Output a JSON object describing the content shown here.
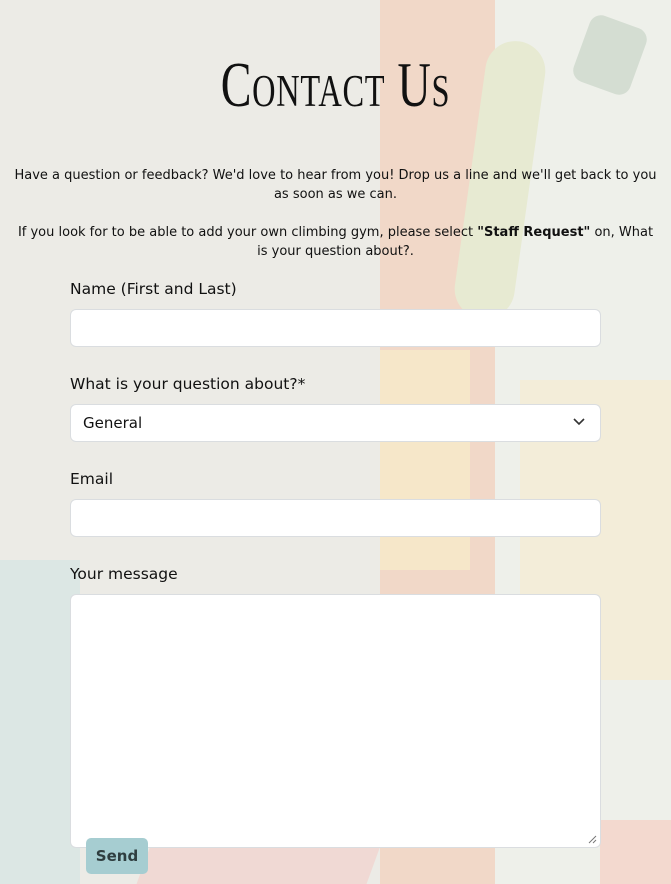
{
  "page": {
    "title": "Contact Us",
    "intro_line1": "Have a question or feedback? We'd love to hear from you! Drop us a line and we'll get back to you as soon as we can.",
    "intro_line2_pre": "If you look for to be able to add your own climbing gym, please select ",
    "intro_line2_bold": "\"Staff Request\"",
    "intro_line2_post": " on, What is your question about?."
  },
  "form": {
    "name_label": "Name (First and Last)",
    "name_value": "",
    "topic_label": "What is your question about?*",
    "topic_selected": "General",
    "email_label": "Email",
    "email_value": "",
    "message_label": "Your message",
    "message_value": "",
    "send_label": "Send"
  },
  "icons": {
    "select_arrow": "chevron-down-icon",
    "resize_handle": "resize-grip-icon"
  },
  "colors": {
    "send_button": "#a6cdd1",
    "field_background": "#ffffff"
  }
}
